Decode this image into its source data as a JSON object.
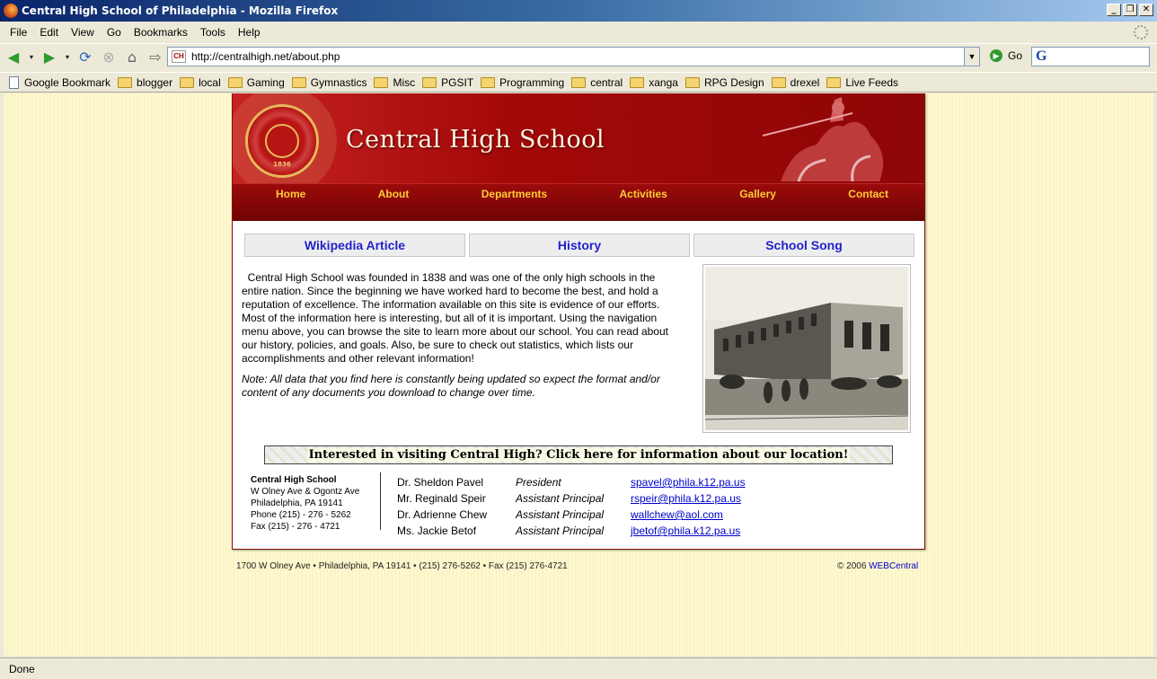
{
  "window": {
    "title": "Central High School of Philadelphia - Mozilla Firefox"
  },
  "menu": [
    "File",
    "Edit",
    "View",
    "Go",
    "Bookmarks",
    "Tools",
    "Help"
  ],
  "navbar": {
    "url": "http://centralhigh.net/about.php",
    "go_label": "Go",
    "favicon_text": "CH"
  },
  "bookmarks": [
    {
      "label": "Google Bookmark",
      "icon": "page"
    },
    {
      "label": "blogger",
      "icon": "folder"
    },
    {
      "label": "local",
      "icon": "folder"
    },
    {
      "label": "Gaming",
      "icon": "folder"
    },
    {
      "label": "Gymnastics",
      "icon": "folder"
    },
    {
      "label": "Misc",
      "icon": "folder"
    },
    {
      "label": "PGSIT",
      "icon": "folder"
    },
    {
      "label": "Programming",
      "icon": "folder"
    },
    {
      "label": "central",
      "icon": "folder"
    },
    {
      "label": "xanga",
      "icon": "folder"
    },
    {
      "label": "RPG Design",
      "icon": "folder"
    },
    {
      "label": "drexel",
      "icon": "folder"
    },
    {
      "label": "Live Feeds",
      "icon": "folder"
    }
  ],
  "site": {
    "title": "Central High School",
    "seal_year": "1836",
    "nav": [
      "Home",
      "About",
      "Departments",
      "Activities",
      "Gallery",
      "Contact"
    ],
    "tabs": [
      "Wikipedia Article",
      "History",
      "School Song"
    ],
    "about_text": "  Central High School was founded in 1838 and was one of the only high schools in the entire nation. Since the beginning we have worked hard to become the best, and hold a reputation of excellence. The information available on this site is evidence of our efforts. Most of the information here is interesting, but all of it is important. Using the navigation menu above, you can browse the site to learn more about our school. You can read about our history, policies, and goals. Also, be sure to check out statistics, which lists our accomplishments and other relevant information!",
    "note": "Note: All data that you find here is constantly being updated so expect the format and/or content of any documents you download to change over time.",
    "location_banner": "Interested in visiting Central High?  Click here for information about our location!",
    "address": {
      "name": "Central High School",
      "line1": "W Olney Ave & Ogontz Ave",
      "line2": "Philadelphia, PA 19141",
      "phone": "Phone (215) - 276 - 5262",
      "fax": "Fax (215) - 276 - 4721"
    },
    "staff": [
      {
        "name": "Dr. Sheldon Pavel",
        "role": "President",
        "email": "spavel@phila.k12.pa.us"
      },
      {
        "name": "Mr. Reginald Speir",
        "role": "Assistant Principal",
        "email": "rspeir@phila.k12.pa.us"
      },
      {
        "name": "Dr. Adrienne Chew",
        "role": "Assistant Principal",
        "email": "wallchew@aol.com"
      },
      {
        "name": "Ms. Jackie Betof",
        "role": "Assistant Principal",
        "email": "jbetof@phila.k12.pa.us"
      }
    ],
    "footer_left": "1700 W Olney Ave • Philadelphia, PA 19141 • (215) 276-5262 • Fax (215) 276-4721",
    "footer_copyright": "© 2006 ",
    "footer_link": "WEBCentral"
  },
  "status": "Done"
}
